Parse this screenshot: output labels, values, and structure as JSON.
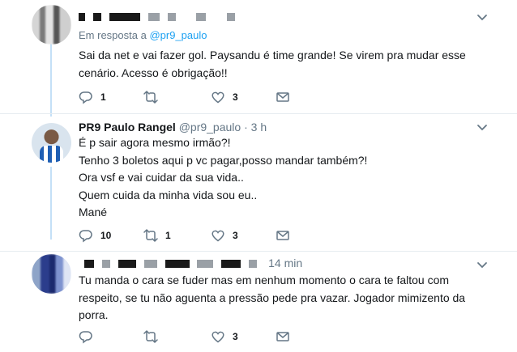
{
  "tweets": [
    {
      "replying_prefix": "Em resposta a",
      "replying_to": "@pr9_paulo",
      "lines": [
        "Sai da net e vai fazer gol. Paysandu é time grande! Se virem pra mudar esse",
        "cenário. Acesso é obrigação!!"
      ],
      "replies": "1",
      "retweets": "",
      "likes": "3"
    },
    {
      "display_name": "PR9 Paulo Rangel",
      "handle": "@pr9_paulo",
      "separator": "·",
      "time": "3 h",
      "lines": [
        "É p sair agora mesmo irmão?!",
        "Tenho 3 boletos aqui p vc pagar,posso mandar também?!",
        "Ora vsf e vai cuidar da sua vida..",
        "Quem cuida da minha vida sou eu..",
        "Mané"
      ],
      "replies": "10",
      "retweets": "1",
      "likes": "3"
    },
    {
      "time": "14 min",
      "lines": [
        "Tu manda o cara se fuder mas em nenhum momento o cara te faltou com",
        "respeito, se tu não aguenta a pressão pede pra vazar. Jogador mimizento da",
        "porra."
      ],
      "replies": "",
      "retweets": "",
      "likes": "3"
    }
  ],
  "icons": [
    "reply-icon",
    "retweet-icon",
    "like-icon",
    "message-icon",
    "chevron-down-icon"
  ],
  "colors": {
    "accent": "#1da1f2",
    "muted": "#657786",
    "text": "#14171a",
    "thread_line": "#c4e0f7"
  }
}
